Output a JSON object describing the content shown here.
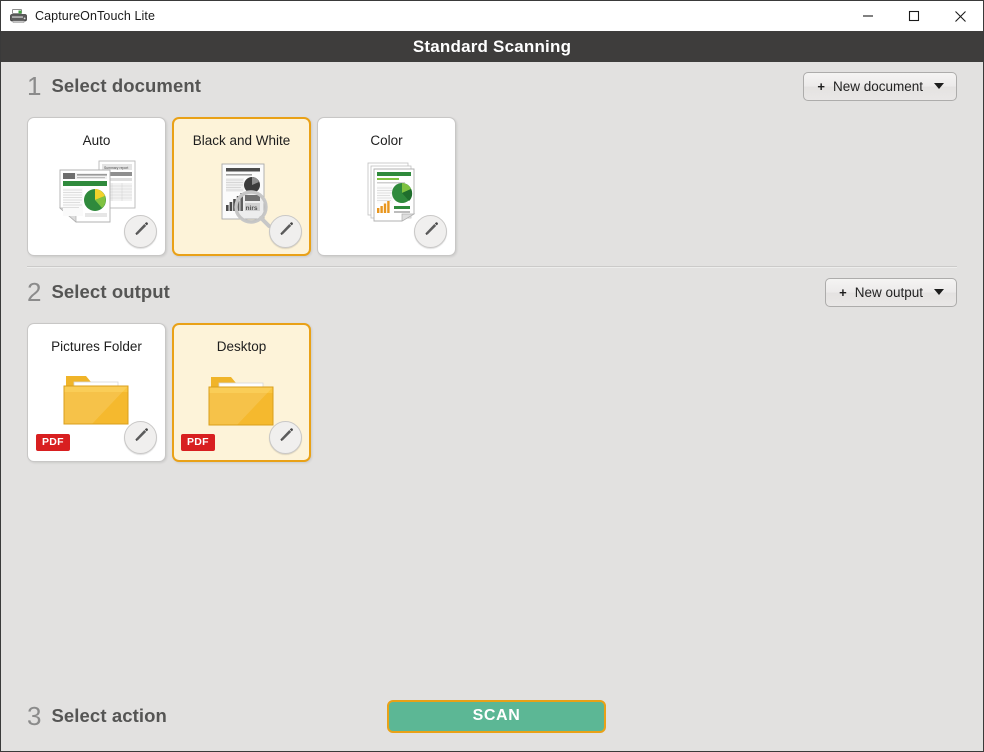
{
  "window": {
    "title": "CaptureOnTouch Lite",
    "app_icon": "scanner-icon",
    "controls": {
      "minimize": "minimize-icon",
      "maximize": "maximize-icon",
      "close": "close-icon"
    }
  },
  "header": {
    "title": "Standard Scanning"
  },
  "sections": [
    {
      "number": "1",
      "label": "Select document",
      "action_button": {
        "plus": "+",
        "label": "New document",
        "caret": "chevron-down-icon"
      },
      "tiles": [
        {
          "title": "Auto",
          "selected": false,
          "thumb": "color-document-pages-icon",
          "edit": "pencil-icon"
        },
        {
          "title": "Black and White",
          "selected": true,
          "thumb": "bw-document-page-icon",
          "edit": "pencil-icon"
        },
        {
          "title": "Color",
          "selected": false,
          "thumb": "color-document-stack-icon",
          "edit": "pencil-icon"
        }
      ]
    },
    {
      "number": "2",
      "label": "Select output",
      "action_button": {
        "plus": "+",
        "label": "New output",
        "caret": "chevron-down-icon"
      },
      "tiles": [
        {
          "title": "Pictures Folder",
          "selected": false,
          "thumb": "folder-icon",
          "badge": "PDF",
          "edit": "pencil-icon"
        },
        {
          "title": "Desktop",
          "selected": true,
          "thumb": "folder-icon",
          "badge": "PDF",
          "edit": "pencil-icon"
        }
      ]
    },
    {
      "number": "3",
      "label": "Select action",
      "scan_button": "SCAN"
    }
  ],
  "colors": {
    "header_band": "#3e3d3c",
    "body_background": "#e2e1e0",
    "selected_tile_fill": "#fdf3d9",
    "selected_tile_border": "#e9a117",
    "scan_button_fill": "#5cb795",
    "scan_button_border": "#e9a117",
    "pdf_badge": "#d81f20",
    "step_number": "#8b8b8b",
    "step_label": "#555554"
  }
}
